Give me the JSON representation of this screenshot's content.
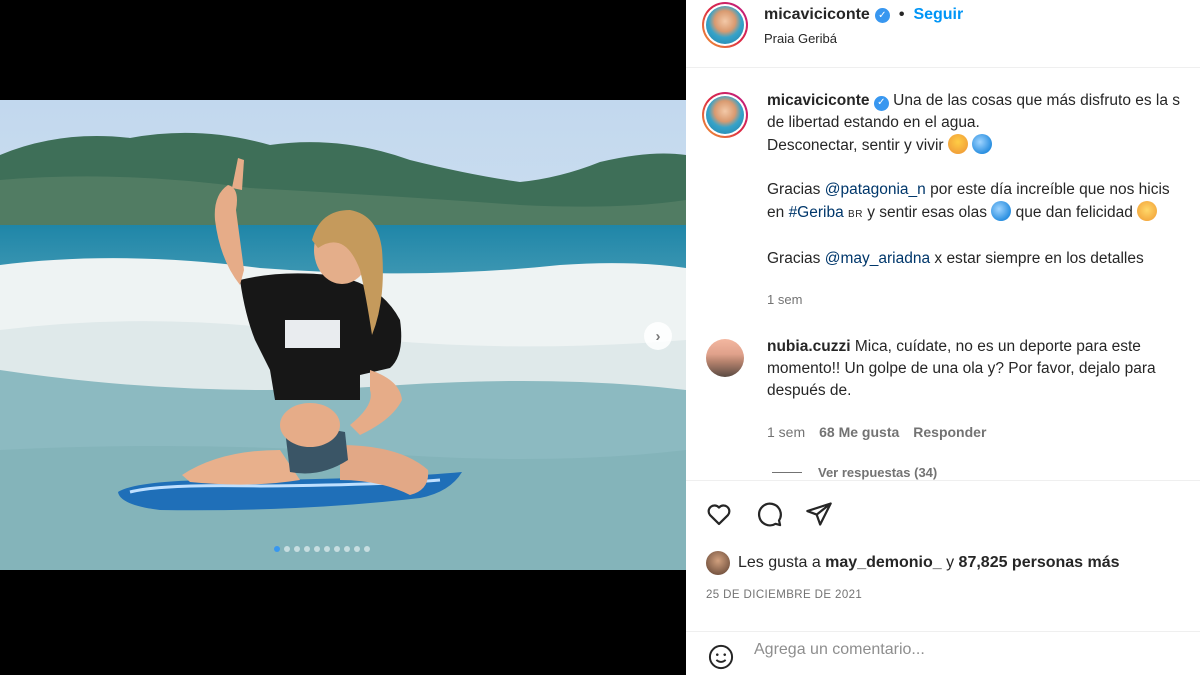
{
  "post": {
    "username": "micaviciconte",
    "follow_label": "Seguir",
    "separator": "•",
    "location": "Praia Geribá"
  },
  "media": {
    "carousel_dots": 10,
    "active_dot": 0,
    "next_icon": "chevron-right-icon"
  },
  "caption": {
    "username": "micaviciconte",
    "line1": "Una de las cosas que más disfruto es la s",
    "line2": "de libertad estando en el agua.",
    "line3": "Desconectar, sentir y vivir",
    "line4_pre": "Gracias ",
    "line4_link": "@patagonia_n",
    "line4_post": " por este día increíble que nos hicis",
    "line5_pre": "en ",
    "line5_link": "#Geriba",
    "line5_br": "BR",
    "line5_post": " y sentir esas olas",
    "line5_end": " que dan felicidad",
    "line6_pre": "Gracias ",
    "line6_link": "@may_ariadna",
    "line6_post": " x estar siempre en los detalles",
    "time": "1 sem"
  },
  "comment": {
    "username": "nubia.cuzzi",
    "text": "Mica, cuídate, no es un deporte para este momento!! Un golpe de una ola y? Por favor, dejalo para después de.",
    "time": "1 sem",
    "likes": "68 Me gusta",
    "reply_label": "Responder",
    "view_replies": "Ver respuestas (34)"
  },
  "actions": {
    "icons": [
      "heart-icon",
      "comment-icon",
      "share-icon"
    ],
    "likes_pre": "Les gusta a ",
    "likes_user": "may_demonio_",
    "likes_mid": " y ",
    "likes_count": "87,825 personas más",
    "date": "25 DE DICIEMBRE DE 2021",
    "comment_placeholder": "Agrega un comentario..."
  },
  "colors": {
    "accent": "#0095f6",
    "link": "#00376b",
    "muted": "#737373",
    "verified": "#3897f0"
  }
}
